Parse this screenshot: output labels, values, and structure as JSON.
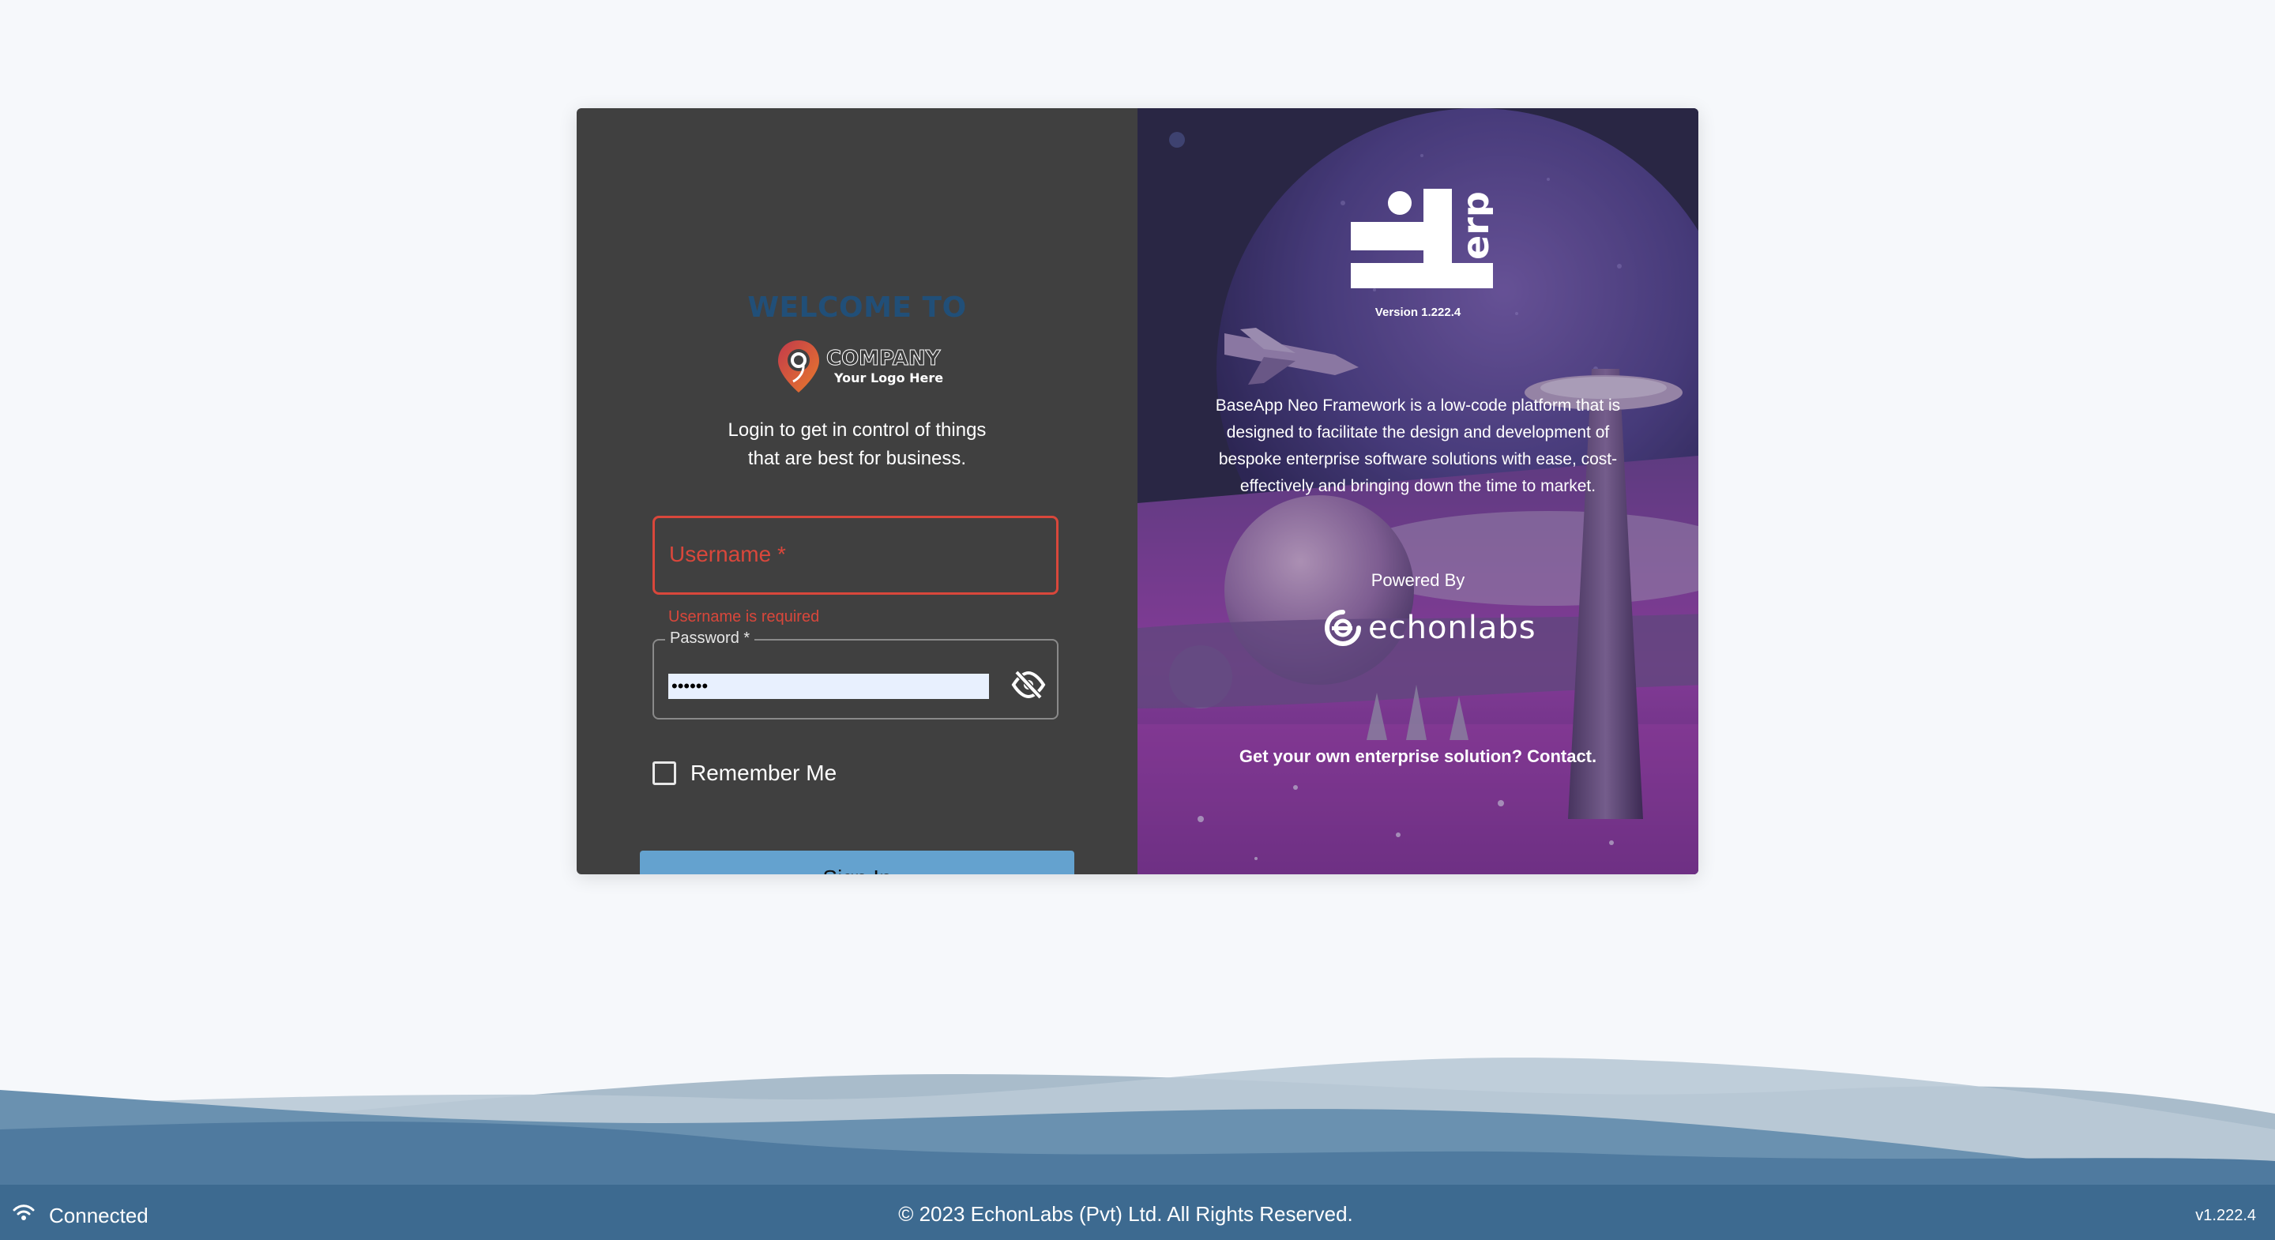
{
  "login": {
    "welcome": "WELCOME TO",
    "company_name": "COMPANY",
    "company_sub": "Your Logo Here",
    "tagline_line1": "Login to get in control of things",
    "tagline_line2": "that are best for business.",
    "username_label": "Username *",
    "username_value": "",
    "username_error": "Username is required",
    "password_label": "Password *",
    "password_value": "••••••",
    "remember_label": "Remember Me",
    "remember_checked": false,
    "sign_in_label": "Sign In"
  },
  "brand_panel": {
    "logo_text": "erp",
    "version": "Version 1.222.4",
    "description": "BaseApp Neo Framework is a low-code platform that is designed to facilitate the design and development of bespoke enterprise software solutions with ease, cost-effectively and bringing down the time to market.",
    "powered_by": "Powered By",
    "vendor_logo_text": "echonlabs",
    "contact": "Get your own enterprise solution? Contact."
  },
  "footer": {
    "status": "Connected",
    "copyright": "© 2023 EchonLabs (Pvt) Ltd. All Rights Reserved.",
    "version": "v1.222.4"
  },
  "colors": {
    "page_bg": "#f6f8fb",
    "left_panel_bg": "#404040",
    "welcome": "#214f78",
    "error": "#d9473b",
    "button_bg": "#64a2cf",
    "footer_bg": "#3d6a90"
  },
  "icons": {
    "company": "map-pin-icon",
    "password_toggle": "eye-off-icon",
    "status": "wifi-icon"
  }
}
